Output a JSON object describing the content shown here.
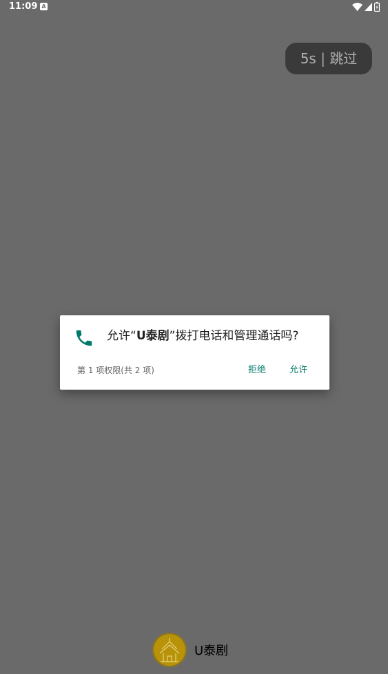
{
  "status_bar": {
    "time": "11:09",
    "notification_icon": "A",
    "icons": [
      "wifi-icon",
      "cell-signal-icon",
      "battery-icon"
    ]
  },
  "splash": {
    "skip_label": "5s | 跳过"
  },
  "permission_dialog": {
    "message_prefix": "允许“",
    "app_name": "U泰剧",
    "message_suffix": "”拨打电话和管理通话吗?",
    "counter": "第 1 项权限(共 2 项)",
    "deny_label": "拒绝",
    "allow_label": "允许",
    "icon": "phone-icon",
    "accent_color": "#00796b"
  },
  "brand": {
    "name": "U泰剧",
    "logo_color": "#b8930a"
  },
  "colors": {
    "scrim": "#6a6a6a",
    "dialog_bg": "#ffffff"
  }
}
